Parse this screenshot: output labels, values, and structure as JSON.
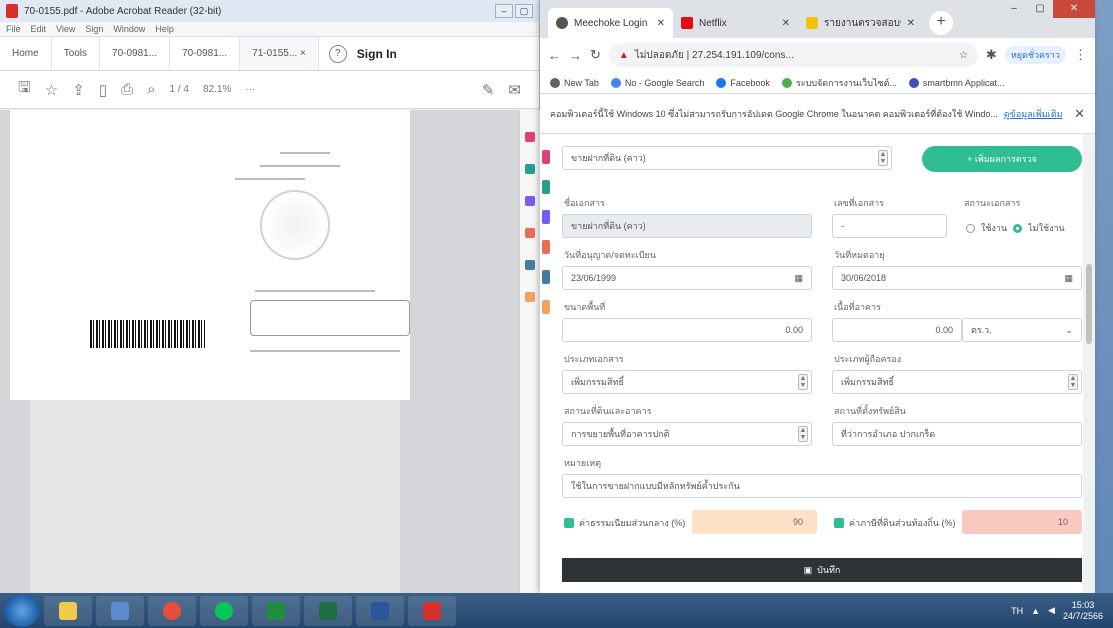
{
  "acrobat": {
    "title": "70-0155.pdf - Adobe Acrobat Reader (32-bit)",
    "menu": [
      "File",
      "Edit",
      "View",
      "Sign",
      "Window",
      "Help"
    ],
    "tabs": [
      "Home",
      "Tools",
      "70-0981...",
      "70-0981...",
      "71-0155... ×"
    ],
    "signin": "Sign In",
    "page_indicator": "1 / 4",
    "zoom": "82.1%"
  },
  "chrome": {
    "tabs": [
      {
        "label": "Meechoke Login",
        "color": "#ffffff",
        "active": true
      },
      {
        "label": "Netflix",
        "color": "#e50914",
        "active": false
      },
      {
        "label": "รายงานตรวจสอบข้อมูล",
        "color": "#f4c20d",
        "active": false
      }
    ],
    "url": "ไม่ปลอดภัย | 27.254.191.109/cons...",
    "profile": "หยุดชั่วคราว",
    "bookmarks": [
      {
        "label": "New Tab",
        "color": "#5f6368"
      },
      {
        "label": "No - Google Search",
        "color": "#4285f4"
      },
      {
        "label": "Facebook",
        "color": "#1877f2"
      },
      {
        "label": "ระบบจัดการงานเว็บไซต์...",
        "color": "#4caf50"
      },
      {
        "label": "smartbmn Applicat...",
        "color": "#3f51b5"
      }
    ],
    "infobar": {
      "text": "คอมพิวเตอร์นี้ใช้ Windows 10 ซึ่งไม่สามารถรับการอัปเดต Google Chrome ในอนาคต คอมพิวเตอร์ที่ต้องใช้ Windo...",
      "link": "ดูข้อมูลเพิ่มเติม"
    }
  },
  "form": {
    "top_select": "ขายฝากที่ดิน (คาว)",
    "add_button": "+ เพิ่มผลการตรวจ",
    "label_name": "ชื่อเอกสาร",
    "value_name": "ขายฝากที่ดิน (คาว)",
    "label_docno": "เลขที่เอกสาร",
    "value_docno": "-",
    "label_status": "สถานะเอกสาร",
    "radio_yes": "ใช้งาน",
    "radio_no": "ไม่ใช้งาน",
    "label_issue": "วันที่อนุญาต/จดทะเบียน",
    "value_issue": "23/06/1999",
    "label_expire": "วันที่หมดอายุ",
    "value_expire": "30/06/2018",
    "label_area": "ขนาดพื้นที่",
    "value_area": "0.00",
    "label_area2": "เนื้อที่อาคาร",
    "value_area2": "0.00",
    "unit": "ตร.ว.",
    "label_type1": "ประเภทเอกสาร",
    "value_type1": "เพิ่มกรรมสิทธิ์",
    "label_type2": "ประเภทผู้ถือครอง",
    "value_type2": "เพิ่มกรรมสิทธิ์",
    "label_owner": "สถานะที่ดินและอาคาร",
    "value_owner": "การขยายพื้นที่อาคารปกติ",
    "label_place": "สถานที่ตั้งทรัพย์สิน",
    "value_place": "ที่ว่าการอำเภอ ปากเกร็ด",
    "label_note": "หมายเหตุ",
    "value_note": "ใช้ในการขายฝากแบบมีหลักทรัพย์ค้ำประกัน",
    "check1": "ค่าธรรมเนียมส่วนกลาง (%)",
    "pct1": "90",
    "pct1_color": "#fde2c8",
    "check2": "ค่าภาษีที่ดินส่วนท้องถิ่น (%)",
    "pct2": "10",
    "pct2_color": "#f7c9c0",
    "save": "บันทึก"
  },
  "taskbar": {
    "lang": "TH",
    "time": "15:03",
    "date": "24/7/2566"
  }
}
